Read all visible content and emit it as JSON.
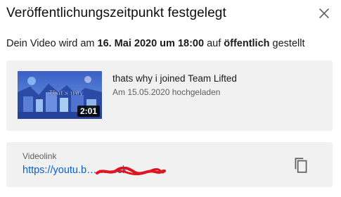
{
  "dialog": {
    "title": "Veröffentlichungszeitpunkt festgelegt",
    "close_icon": "close-icon"
  },
  "message": {
    "prefix": "Dein Video wird am ",
    "date_time": "16. Mai 2020 um 18:00",
    "middle": " auf ",
    "visibility": "öffentlich",
    "suffix": " gestellt"
  },
  "video": {
    "title": "thats why i joined Team Lifted",
    "uploaded": "Am 15.05.2020 hochgeladen",
    "duration": "2:01",
    "thumbnail_text": "That's why"
  },
  "link": {
    "label": "Videolink",
    "url": "https://youtu.b………ck",
    "copy_icon": "copy-icon"
  },
  "colors": {
    "link": "#065fd4",
    "card_bg": "#f1f1f1",
    "redaction": "#e0141e"
  }
}
